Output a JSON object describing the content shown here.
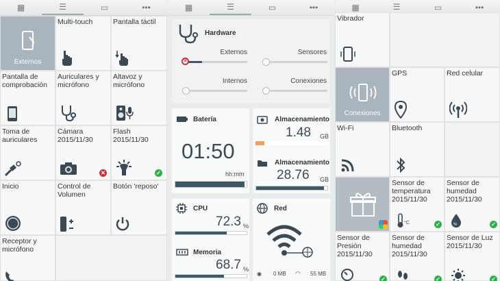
{
  "panel1": {
    "tiles": [
      {
        "label": "Externos"
      },
      {
        "label": "Multi-touch"
      },
      {
        "label": "Pantalla táctil"
      },
      {
        "label": "Pantalla de\ncomprobación"
      },
      {
        "label": "Auriculares y\nmicrófono"
      },
      {
        "label": "Altavoz y\nmicrófono"
      },
      {
        "label": "Toma de\nauriculares"
      },
      {
        "label": "Cámara\n2015/11/30"
      },
      {
        "label": "Flash\n2015/11/30"
      },
      {
        "label": "Inicio"
      },
      {
        "label": "Control de\nVolumen"
      },
      {
        "label": "Botón 'reposo'"
      },
      {
        "label": "Receptor y\nmicrófono"
      }
    ]
  },
  "panel2": {
    "hardware": {
      "title": "Hardware",
      "externos": "Externos",
      "sensores": "Sensores",
      "internos": "Internos",
      "conexiones": "Conexiones"
    },
    "bateria": {
      "title": "Batería",
      "time": "01:50",
      "unit": "hh:mm",
      "level": 0.97
    },
    "storage1": {
      "title": "Almacenamiento",
      "value": "1.48",
      "unit": "GB",
      "level": 0.12
    },
    "storage2": {
      "title": "Almacenamiento",
      "value": "28.76",
      "unit": "GB",
      "level": 0.95
    },
    "cpu": {
      "title": "CPU",
      "value": "72.3",
      "unit": "%",
      "level": 0.72
    },
    "memoria": {
      "title": "Memoria",
      "value": "68.7",
      "unit": "%",
      "level": 0.68
    },
    "red": {
      "title": "Red",
      "mobile": "0 MB",
      "wifi": "55 MB"
    }
  },
  "panel3": {
    "tiles": [
      {
        "label": "Vibrador"
      },
      {
        "label": "Conexiones"
      },
      {
        "label": "GPS"
      },
      {
        "label": "Red celular"
      },
      {
        "label": "Wi-Fi"
      },
      {
        "label": "Bluetooth"
      },
      {
        "label": "Sensor de\ntemperatura\n2015/11/30"
      },
      {
        "label": "Sensor de\nhumedad\n2015/11/30"
      },
      {
        "label": "Sensor de\nPresión\n2015/11/30"
      },
      {
        "label": "Sensor de\nhumedad\n2015/11/30"
      },
      {
        "label": "Sensor de Luz\n2015/11/30"
      }
    ]
  },
  "colors": {
    "accent_dark": "#3e5866",
    "ok": "#2eb14a",
    "fail": "#c8343a",
    "selected_tile": "#aab4bc",
    "storage_orange": "#f0a060"
  }
}
